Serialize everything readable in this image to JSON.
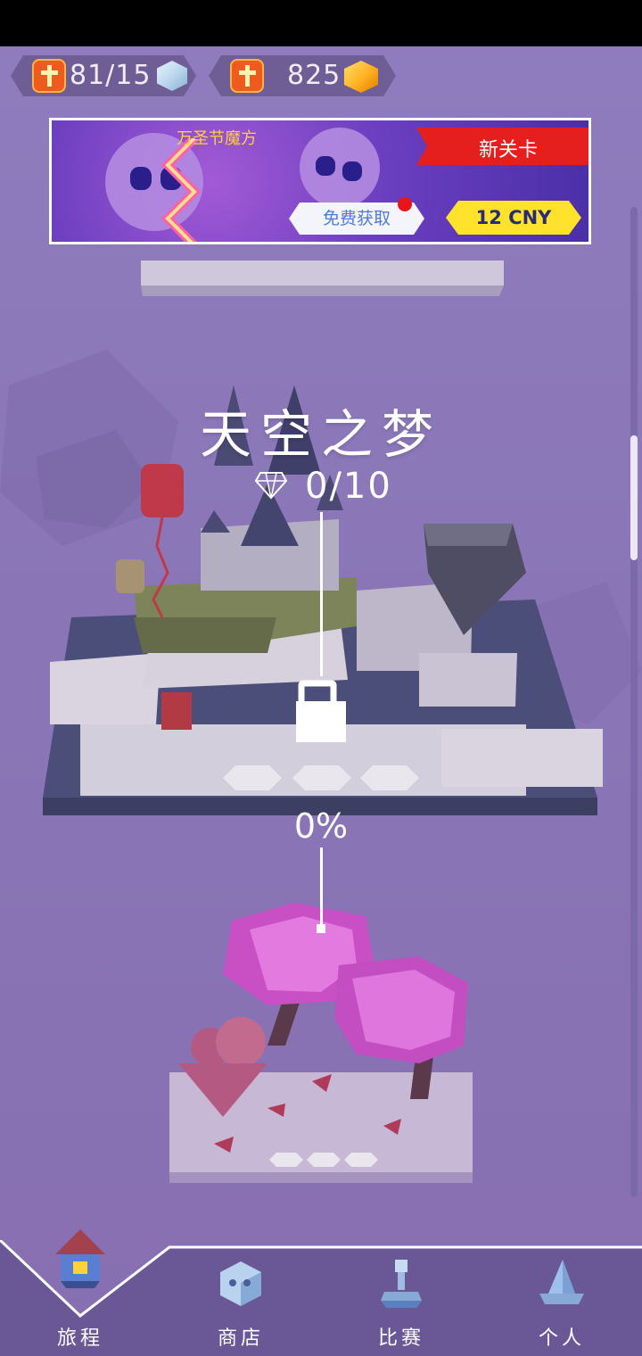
{
  "header": {
    "lives": {
      "icon": "cross-icon",
      "value": "81/15",
      "cube": "blue-cube-icon"
    },
    "gems": {
      "icon": "cross-icon",
      "value": "825",
      "cube": "gold-cube-icon"
    }
  },
  "banner": {
    "title": "万圣节魔方",
    "new_level_label": "新关卡",
    "free_label": "免费获取",
    "price_label": "12 CNY"
  },
  "level": {
    "title": "天空之梦",
    "diamond_icon": "diamond-icon",
    "diamonds": "0/10",
    "locked": true,
    "progress": "0%"
  },
  "nav": {
    "items": [
      {
        "label": "旅程",
        "icon": "house-icon",
        "active": true
      },
      {
        "label": "商店",
        "icon": "skull-icon",
        "active": false
      },
      {
        "label": "比赛",
        "icon": "trophy-icon",
        "active": false
      },
      {
        "label": "个人",
        "icon": "wizard-hat-icon",
        "active": false
      }
    ]
  },
  "colors": {
    "background": "#8b77b8",
    "accent_red": "#e51e1e",
    "price_yellow": "#ffe22b",
    "nav_bg": "#6a5896"
  }
}
